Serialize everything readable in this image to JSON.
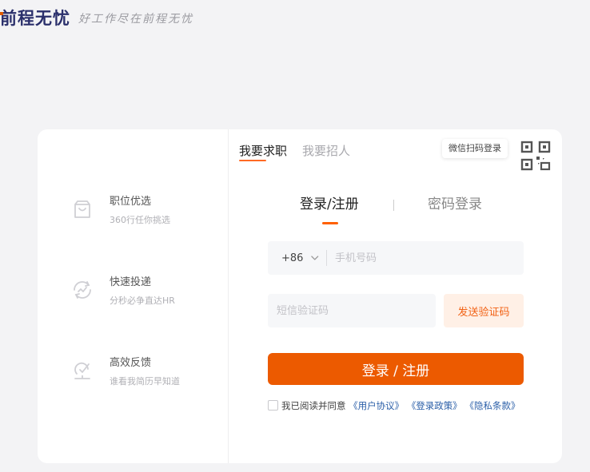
{
  "brand": {
    "name": "前程无忧",
    "slogan": "好工作尽在前程无忧"
  },
  "features": [
    {
      "icon": "shopping-bag-icon",
      "title": "职位优选",
      "desc": "360行任你挑选"
    },
    {
      "icon": "refresh-chart-icon",
      "title": "快速投递",
      "desc": "分秒必争直达HR"
    },
    {
      "icon": "feedback-icon",
      "title": "高效反馈",
      "desc": "谁看我简历早知道"
    }
  ],
  "role_tabs": [
    {
      "label": "我要求职",
      "active": true
    },
    {
      "label": "我要招人",
      "active": false
    }
  ],
  "wechat_login": {
    "label": "微信扫码登录",
    "icon": "qr-code-icon"
  },
  "login_tabs": [
    {
      "label": "登录/注册",
      "active": true
    },
    {
      "label": "密码登录",
      "active": false
    }
  ],
  "phone": {
    "country_code": "+86",
    "placeholder": "手机号码",
    "value": ""
  },
  "sms": {
    "placeholder": "短信验证码",
    "value": "",
    "send_label": "发送验证码"
  },
  "submit_label": "登录 / 注册",
  "agreement": {
    "checked": false,
    "prefix": "我已阅读并同意",
    "links": [
      "《用户协议》",
      "《登录政策》",
      "《隐私条款》"
    ]
  },
  "colors": {
    "accent": "#ec5a00",
    "link": "#2b5fa8",
    "background": "#f3f3f5",
    "brand_navy": "#2a2f6b"
  }
}
